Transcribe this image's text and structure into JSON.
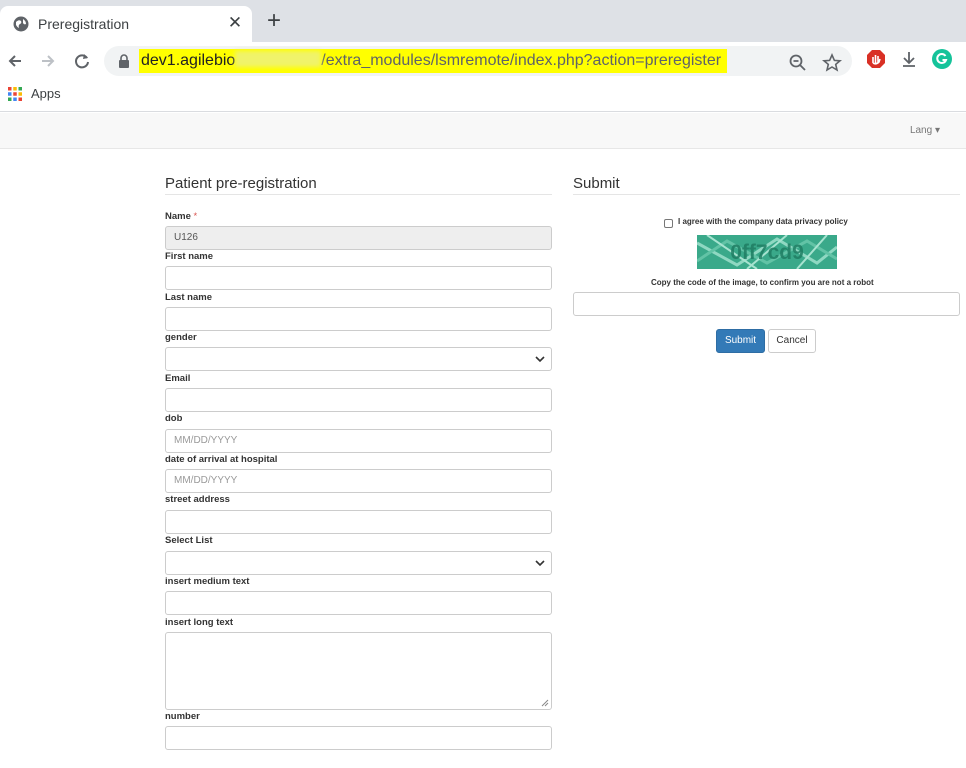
{
  "browser": {
    "tab_title": "Preregistration",
    "url_host": "dev1.agilebio",
    "url_path": "/extra_modules/lsmremote/index.php?action=preregister",
    "bookmark_apps": "Apps",
    "icons": [
      "globe-icon",
      "close-icon",
      "plus-icon",
      "back-icon",
      "forward-icon",
      "reload-icon",
      "lock-icon",
      "zoom-icon",
      "star-icon",
      "adblock-icon",
      "download-icon",
      "grammarly-icon",
      "apps-grid-icon"
    ]
  },
  "navbar": {
    "lang": "Lang"
  },
  "form": {
    "title": "Patient pre-registration",
    "required_mark": "*",
    "fields": {
      "name": {
        "label": "Name",
        "value": "U126"
      },
      "first_name": {
        "label": "First name"
      },
      "last_name": {
        "label": "Last name"
      },
      "gender": {
        "label": "gender"
      },
      "email": {
        "label": "Email"
      },
      "dob": {
        "label": "dob",
        "placeholder": "MM/DD/YYYY"
      },
      "arrival": {
        "label": "date of arrival at hospital",
        "placeholder": "MM/DD/YYYY"
      },
      "street": {
        "label": "street address"
      },
      "select_list": {
        "label": "Select List"
      },
      "medium_text": {
        "label": "insert medium text"
      },
      "long_text": {
        "label": "insert long text"
      },
      "number": {
        "label": "number"
      }
    }
  },
  "submit_panel": {
    "title": "Submit",
    "privacy_label": "I agree with the company data privacy policy",
    "captcha_code": "0ff7cd9",
    "captcha_instruction": "Copy the code of the image, to confirm you are not a robot",
    "submit_label": "Submit",
    "cancel_label": "Cancel"
  },
  "colors": {
    "primary": "#337ab7",
    "url_highlight": "#ffff00",
    "captcha_bg": "#3aa98a"
  }
}
